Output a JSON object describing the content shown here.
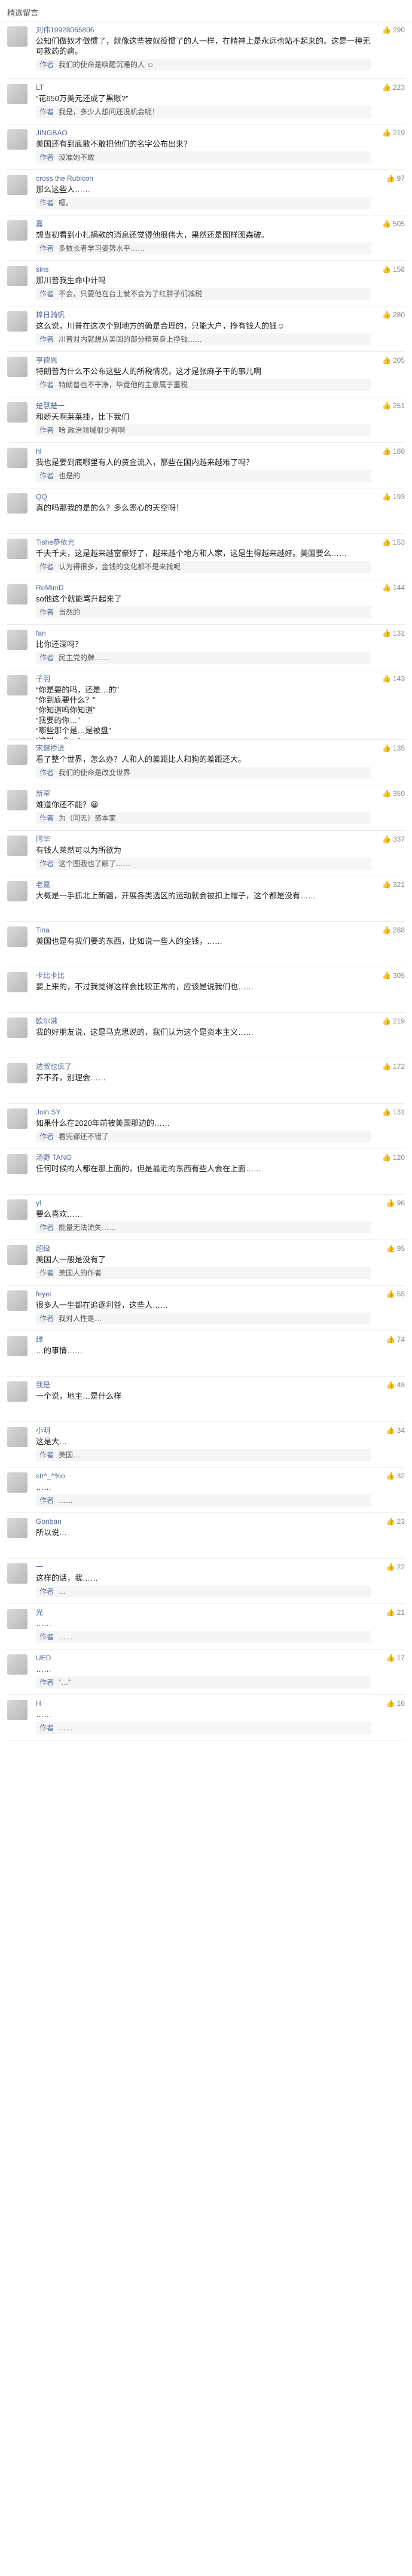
{
  "header": {
    "title": "精选留言"
  },
  "comments": [
    {
      "name": "刘伟19928065806",
      "likes": "290",
      "text": "公知们做奴才做惯了，就像这些被奴役惯了的人一样，在精神上是永远也站不起来的。这是一种无可救药的病。",
      "reply": {
        "tag": "作者",
        "text": "我们的使命是唤醒沉睡的人 ☺",
        "likes": ""
      }
    },
    {
      "name": "LT",
      "likes": "223",
      "text": "“花650万美元还成了黑账?”",
      "reply": {
        "tag": "作者",
        "text": "我是，多少人想问还没机会呢！",
        "likes": ""
      }
    },
    {
      "name": "JINGBAO",
      "likes": "219",
      "text": "美国还有到底敢不敢把他们的名字公布出来？",
      "reply": {
        "tag": "作者",
        "text": "没准她不敢",
        "likes": ""
      }
    },
    {
      "name": "cross the Rubicon",
      "likes": "97",
      "text": "那么这些人……",
      "reply": {
        "tag": "作者",
        "text": "嗯。",
        "likes": ""
      }
    },
    {
      "name": "嘉",
      "likes": "505",
      "text": "想当初看到小扎捐款的消息还觉得他很伟大，果然还是图样图森破。",
      "reply": {
        "tag": "作者",
        "text": "多数长者学习姿势水平……",
        "likes": ""
      }
    },
    {
      "name": "sins",
      "likes": "158",
      "text": "那川普我生命中计吗",
      "reply": {
        "tag": "作者",
        "text": "不会，只要他在台上就不会为了红胖子们减税",
        "likes": ""
      }
    },
    {
      "name": "捧日骑帆",
      "likes": "280",
      "text": "这么说，川普在这次个别地方的确是合理的，只能大户，挣有钱人的钱☺",
      "reply": {
        "tag": "作者",
        "text": "川普对内就想从美国的部分精英身上挣钱……",
        "likes": ""
      }
    },
    {
      "name": "亨德恩",
      "likes": "205",
      "text": "特朗普为什么不公布这些人的所税情况，这才是张麻子干的事儿啊",
      "reply": {
        "tag": "作者",
        "text": "特朗普也不干净，毕竟他的主意属于重税",
        "likes": ""
      }
    },
    {
      "name": "楚慧楚一",
      "likes": "251",
      "text": "和娇天啊莱莱挂，比下我们",
      "reply": {
        "tag": "作者",
        "text": "哈 政治领域很少有啊",
        "likes": ""
      }
    },
    {
      "name": "hl",
      "likes": "186",
      "text": "我也是要到底哪里有人的资金流入，那些在国内越来越难了吗？",
      "reply": {
        "tag": "作者",
        "text": "也是的",
        "likes": ""
      }
    },
    {
      "name": "QQ",
      "likes": "193",
      "text": "真的吗那我的是的么？多么恶心的天空呀！",
      "reply": null
    },
    {
      "name": "Tishe恭依光",
      "likes": "153",
      "text": "千夫千夫，这是越来越富豪好了，越来越个地方和人家，这是生得越来越好。美国要么……",
      "reply": {
        "tag": "作者",
        "text": "认为得很多，金钱的变化都不是来找呢",
        "likes": ""
      }
    },
    {
      "name": "ReMimD",
      "likes": "144",
      "text": "so他这个就能骂升起来了",
      "reply": {
        "tag": "作者",
        "text": "当然的",
        "likes": ""
      }
    },
    {
      "name": "fan",
      "likes": "131",
      "text": "比你还深吗？",
      "reply": {
        "tag": "作者",
        "text": "民主党的牌……",
        "likes": ""
      }
    },
    {
      "name": "子羽",
      "likes": "143",
      "text": "“你是要的吗，还是…的”<br>“你到底要什么？”<br>“你知道吗你知道”<br>“我要的你…”<br>“哪些那个是…是被盘”<br>“这是一个…”",
      "reply": null
    },
    {
      "name": "宋健桥进",
      "likes": "135",
      "text": "看了整个世界，怎么办？人和人的差距比人和狗的差距还大。",
      "reply": {
        "tag": "作者",
        "text": "我们的使命是改变世界",
        "likes": ""
      }
    },
    {
      "name": "新罕",
      "likes": "359",
      "text": "难道你还不能？😀",
      "reply": {
        "tag": "作者",
        "text": "为（同志）资本家",
        "likes": ""
      }
    },
    {
      "name": "阿华",
      "likes": "337",
      "text": "有钱人莱然可以为所欲为",
      "reply": {
        "tag": "作者",
        "text": "这个图我也了解了……",
        "likes": ""
      }
    },
    {
      "name": "老嘉",
      "likes": "321",
      "text": "大概是一手抓北上新疆，开展各类选区的运动就会被扣上帽子，这个都是没有……",
      "reply": null
    },
    {
      "name": "Tina",
      "likes": "288",
      "text": "美国也是有我们要的东西，比如说一些人的金钱，……",
      "reply": null
    },
    {
      "name": "卡比卡比",
      "likes": "305",
      "text": "要上来的，不过我觉得这样会比较正常的，应该是说我们也……",
      "reply": null
    },
    {
      "name": "欧尔沸",
      "likes": "219",
      "text": "我的好朋友说，这是马克思说的，我们认为这个是资本主义……",
      "reply": null
    },
    {
      "name": "达叔也疯了",
      "likes": "172",
      "text": "养不养，别理会……",
      "reply": null
    },
    {
      "name": "Join.SY",
      "likes": "131",
      "text": "如果什么在2020年前被美国那边的……",
      "reply": {
        "tag": "作者",
        "text": "看完都还不错了",
        "likes": ""
      }
    },
    {
      "name": "汤野 TANG",
      "likes": "120",
      "text": "任何时候的人都在那上面的，但是最近的东西有些人会在上面……",
      "reply": null
    },
    {
      "name": "yl",
      "likes": "96",
      "text": "要么喜欢……",
      "reply": {
        "tag": "作者",
        "text": "能量无法流失……",
        "likes": ""
      }
    },
    {
      "name": "超级",
      "likes": "95",
      "text": "美国人一般是没有了",
      "reply": {
        "tag": "作者",
        "text": "美国人的作者",
        "likes": ""
      }
    },
    {
      "name": "feyei",
      "likes": "55",
      "text": "很多人一生都在追逐利益，这些人……",
      "reply": {
        "tag": "作者",
        "text": "我对人性是…",
        "likes": ""
      }
    },
    {
      "name": "绿",
      "likes": "74",
      "text": "…的事情……",
      "reply": null
    },
    {
      "name": "我是",
      "likes": "48",
      "text": "一个说，地主…是什么样",
      "reply": null
    },
    {
      "name": "小明",
      "likes": "34",
      "text": "这是大…",
      "reply": {
        "tag": "作者",
        "text": "美国…",
        "likes": ""
      }
    },
    {
      "name": "str^_^%o",
      "likes": "32",
      "text": "……",
      "reply": {
        "tag": "作者",
        "text": "……",
        "likes": ""
      }
    },
    {
      "name": "Gonban",
      "likes": "23",
      "text": "所以说…",
      "reply": null
    },
    {
      "name": "一",
      "likes": "22",
      "text": "这样的话，我……",
      "reply": {
        "tag": "作者",
        "text": "…",
        "likes": ""
      }
    },
    {
      "name": "光",
      "likes": "21",
      "text": "……",
      "reply": {
        "tag": "作者",
        "text": "……",
        "likes": ""
      }
    },
    {
      "name": "UED",
      "likes": "17",
      "text": "……",
      "reply": {
        "tag": "作者",
        "text": "“…”",
        "likes": ""
      }
    },
    {
      "name": "H",
      "likes": "16",
      "text": "……",
      "reply": {
        "tag": "作者",
        "text": "……",
        "likes": ""
      }
    }
  ]
}
